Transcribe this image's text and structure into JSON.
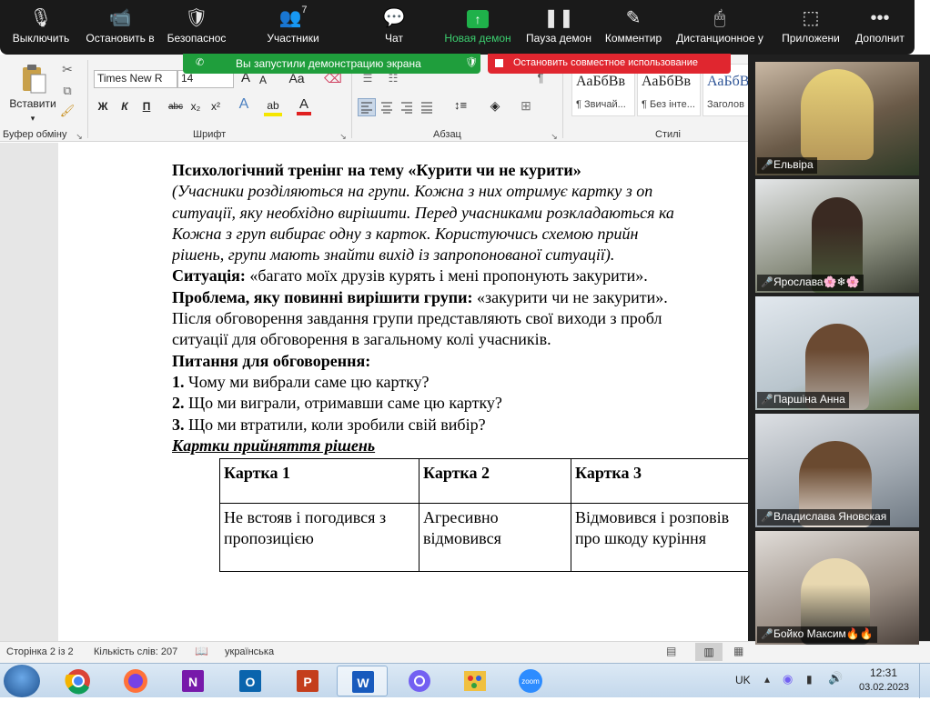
{
  "zoom_toolbar": {
    "items": [
      {
        "label": "Выключить",
        "icon": "microphone-icon"
      },
      {
        "label": "Остановить в",
        "icon": "video-camera-icon"
      },
      {
        "label": "Безопаснос",
        "icon": "shield-icon"
      },
      {
        "label": "Участники",
        "icon": "participants-icon",
        "count": "7"
      },
      {
        "label": "Чат",
        "icon": "chat-icon"
      },
      {
        "label": "Новая демон",
        "icon": "share-screen-icon",
        "glyph": "↑"
      },
      {
        "label": "Пауза демон",
        "icon": "pause-icon"
      },
      {
        "label": "Комментир",
        "icon": "annotate-pen-icon"
      },
      {
        "label": "Дистанционное у",
        "icon": "mouse-icon"
      },
      {
        "label": "Приложени",
        "icon": "apps-icon"
      },
      {
        "label": "Дополнит",
        "icon": "more-icon"
      }
    ]
  },
  "share_banner": {
    "text": "Вы запустили демонстрацию экрана",
    "stop": "Остановить совместное использование"
  },
  "ribbon": {
    "paste": "Вставити",
    "clipboard_group": "Буфер обміну",
    "font_group": "Шрифт",
    "paragraph_group": "Абзац",
    "styles_group": "Стилі",
    "font_name": "Times New R",
    "font_size": "14",
    "aa_big": "A",
    "aa_small": "A",
    "aa_case": "Aa",
    "bold": "Ж",
    "italic": "К",
    "underline": "П",
    "strike": "abc",
    "sub": "x₂",
    "sup": "x²",
    "text_effects": "A",
    "highlight": "ab",
    "font_color": "A",
    "styles": [
      {
        "sample": "АаБбВв",
        "name": "¶ Звичай..."
      },
      {
        "sample": "АаБбВв",
        "name": "¶ Без інте..."
      },
      {
        "sample": "АаБбВ",
        "name": "Заголов"
      }
    ]
  },
  "document": {
    "title": "Психологічний тренінг на тему «Курити чи не курити»",
    "intro_lines": [
      "(Учасники розділяються на групи. Кожна з них отримує картку з оп",
      "ситуації, яку необхідно вирішити. Перед учасниками розкладаються ка",
      "Кожна з груп вибирає одну з карток. Користуючись схемою прийн",
      "рішень, групи мають знайти вихід із запропонованої ситуації)."
    ],
    "situation_label": "Ситуація:",
    "situation_text": " «багато моїх друзів курять і мені пропонують закурити».",
    "problem_label": "Проблема, яку повинні вирішити групи:",
    "problem_text": " «закурити чи не закурити».",
    "after_lines": [
      "Після обговорення завдання групи представляють свої виходи з пробл",
      "ситуації для обговорення в загальному колі учасників."
    ],
    "questions_heading": "Питання для обговорення:",
    "questions": [
      {
        "num": "1.",
        "text": " Чому ми вибрали саме цю картку?"
      },
      {
        "num": "2.",
        "text": " Що ми виграли, отримавши саме цю картку?"
      },
      {
        "num": "3.",
        "text": " Що ми втратили, коли зробили свій вибір?"
      }
    ],
    "cards_heading": "Картки прийняття рішень",
    "cards_table": {
      "headers": [
        "Картка 1",
        "Картка 2",
        "Картка 3"
      ],
      "cells": [
        "Не встояв і погодився з пропозицією",
        "Агресивно відмовився",
        "Відмовився і розповів про шкоду куріння"
      ]
    }
  },
  "status_bar": {
    "page": "Сторінка 2 із 2",
    "words": "Кількість слів: 207",
    "language": "українська"
  },
  "participants": [
    {
      "name": "Ельвіра"
    },
    {
      "name": "Ярослава🌸❄🌸"
    },
    {
      "name": "Паршіна Анна"
    },
    {
      "name": "Владислава Яновская"
    },
    {
      "name": "Бойко Максим🔥🔥"
    }
  ],
  "taskbar": {
    "apps": [
      {
        "name": "chrome-icon"
      },
      {
        "name": "firefox-icon"
      },
      {
        "name": "onenote-icon"
      },
      {
        "name": "outlook-icon"
      },
      {
        "name": "powerpoint-icon"
      },
      {
        "name": "word-icon"
      },
      {
        "name": "viber-icon"
      },
      {
        "name": "paint-icon"
      },
      {
        "name": "zoom-icon"
      }
    ],
    "language": "UK",
    "time": "12:31",
    "date": "03.02.2023",
    "zoom_app_label": "zoom"
  }
}
